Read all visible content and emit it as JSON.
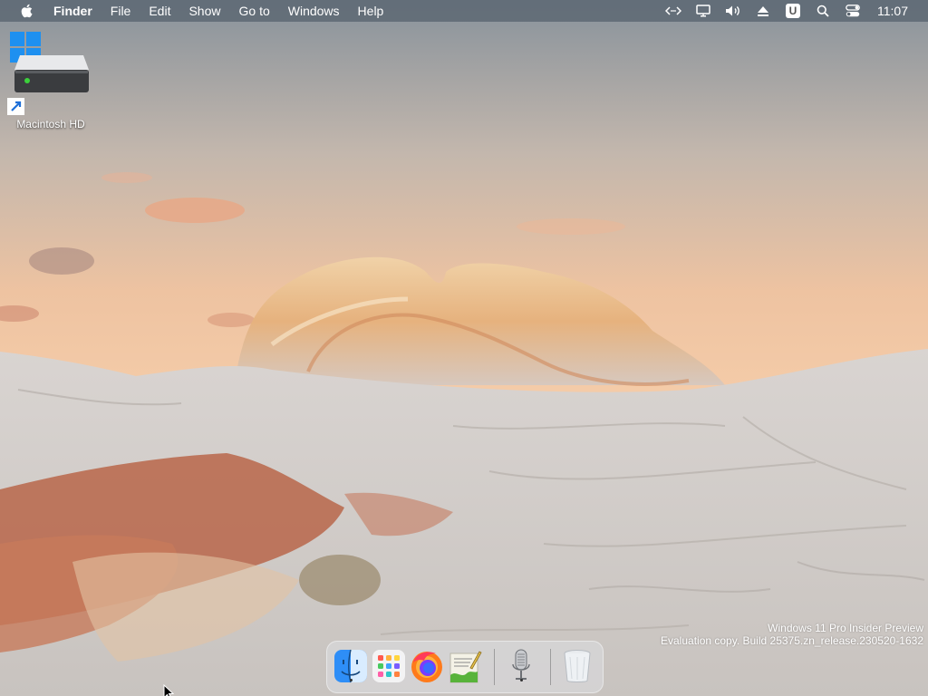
{
  "menubar": {
    "app_name": "Finder",
    "menus": [
      "File",
      "Edit",
      "Show",
      "Go to",
      "Windows",
      "Help"
    ],
    "tray_icons": [
      "code-arrows-icon",
      "display-icon",
      "volume-icon",
      "eject-icon",
      "u-app-icon",
      "search-icon",
      "control-center-icon"
    ],
    "u_badge": "U",
    "clock": "11:07"
  },
  "desktop": {
    "icons": [
      {
        "label": "Macintosh HD",
        "icon": "hard-drive-icon",
        "shortcut": true
      }
    ]
  },
  "watermark": {
    "line1": "Windows 11 Pro Insider Preview",
    "line2": "Evaluation copy. Build 25375.zn_release.230520-1632"
  },
  "dock": {
    "items": [
      {
        "name": "finder",
        "icon": "finder-icon"
      },
      {
        "name": "launchpad",
        "icon": "launchpad-icon"
      },
      {
        "name": "firefox",
        "icon": "firefox-icon"
      },
      {
        "name": "script-editor",
        "icon": "script-editor-icon"
      },
      {
        "name": "voice-control",
        "icon": "microphone-icon"
      },
      {
        "name": "trash",
        "icon": "trash-icon"
      }
    ]
  }
}
